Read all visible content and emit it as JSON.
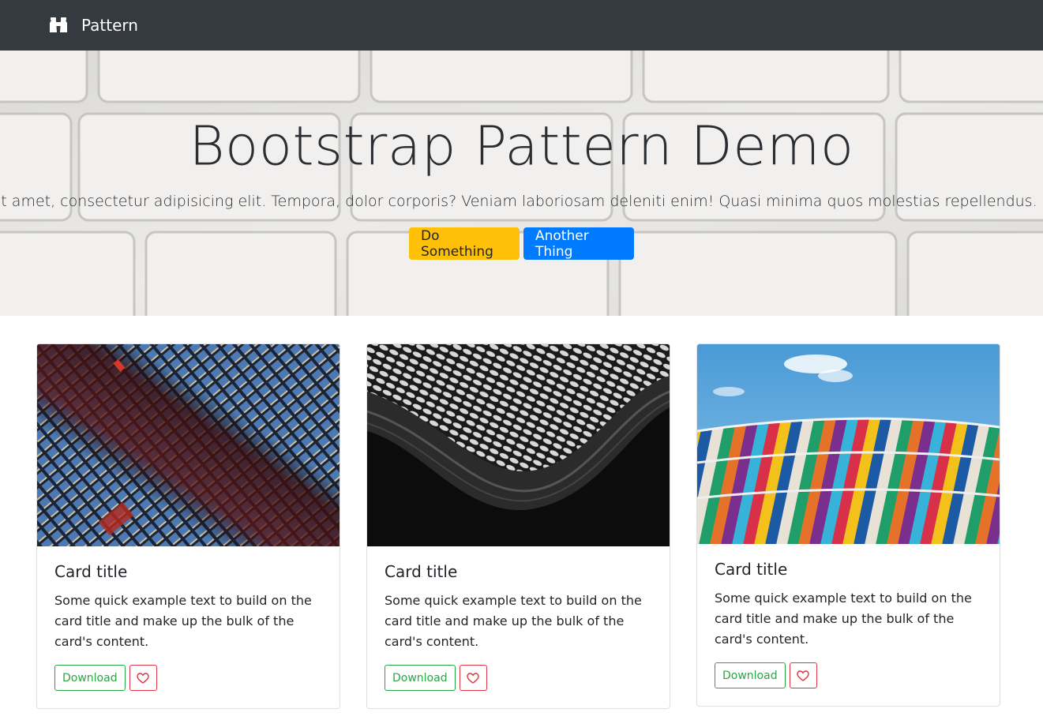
{
  "navbar": {
    "brand_icon": "binoculars-icon",
    "brand_label": "Pattern",
    "background": "#343a40"
  },
  "hero": {
    "title": "Bootstrap Pattern Demo",
    "lead": "Lorem ipsum dolor sit amet, consectetur adipisicing elit. Tempora, dolor corporis? Veniam laboriosam deleniti enim! Quasi minima quos molestias repellendus.",
    "primary_button": "Do Something",
    "secondary_button": "Another Thing",
    "primary_color": "#ffc107",
    "secondary_color": "#007bff"
  },
  "cards": [
    {
      "image": "blue-glass-building-facade",
      "title": "Card title",
      "text": "Some quick example text to build on the card title and make up the bulk of the card's content.",
      "download_label": "Download",
      "favorite_icon": "heart-icon"
    },
    {
      "image": "black-white-wave-architecture",
      "title": "Card title",
      "text": "Some quick example text to build on the card title and make up the bulk of the card's content.",
      "download_label": "Download",
      "favorite_icon": "heart-icon"
    },
    {
      "image": "colorful-panel-building-sky",
      "title": "Card title",
      "text": "Some quick example text to build on the card title and make up the bulk of the card's content.",
      "download_label": "Download",
      "favorite_icon": "heart-icon"
    }
  ],
  "colors": {
    "success": "#28a745",
    "danger": "#dc3545"
  }
}
